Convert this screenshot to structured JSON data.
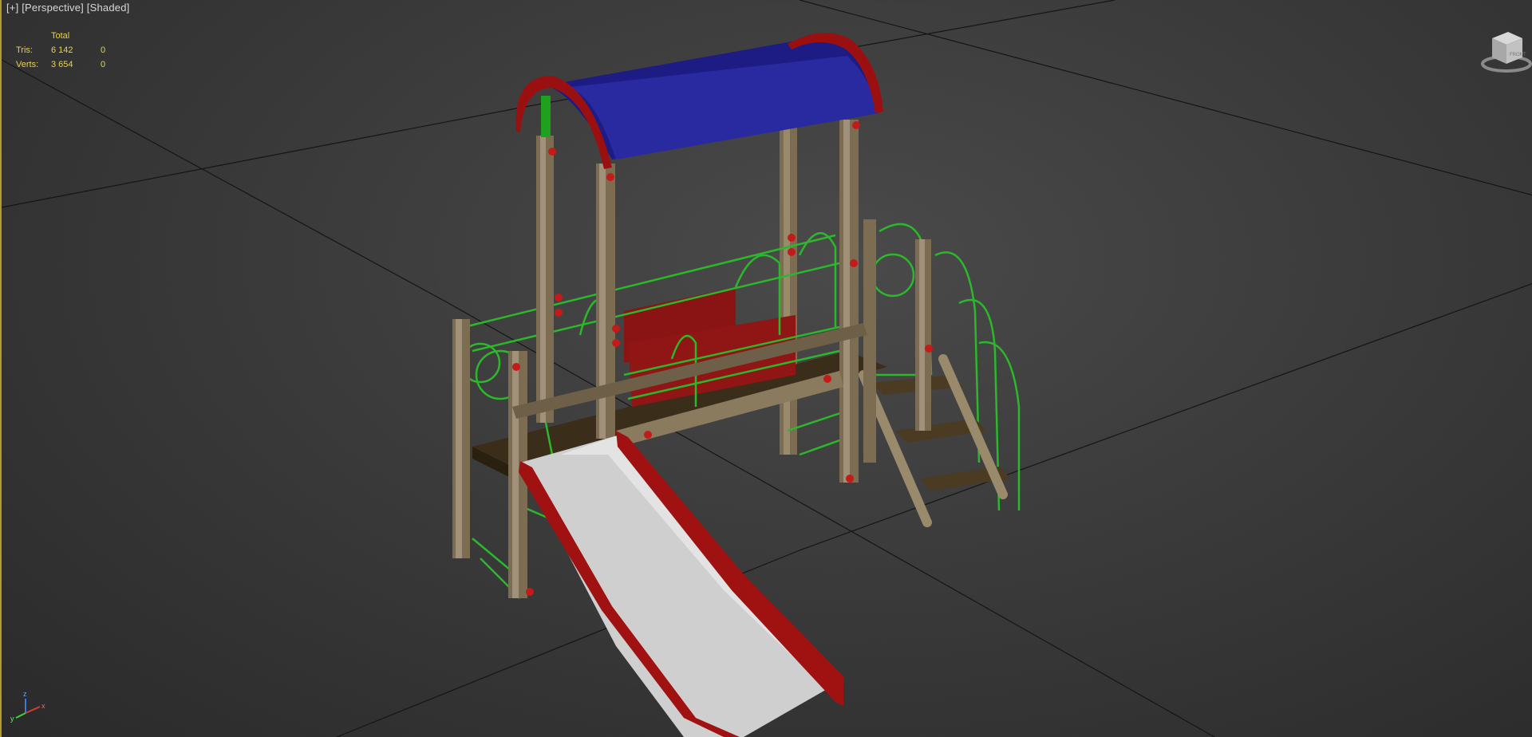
{
  "viewport": {
    "label": {
      "plus": "[+]",
      "view": "[Perspective]",
      "shading": "[Shaded]"
    },
    "stats": {
      "header": "Total",
      "rows": [
        {
          "label": "Tris:",
          "total": "6 142",
          "selected": "0"
        },
        {
          "label": "Verts:",
          "total": "3 654",
          "selected": "0"
        }
      ]
    },
    "viewcube": {
      "face_label": "FRONT"
    },
    "axis_tripod": {
      "z": "z",
      "x": "x",
      "y": "y"
    }
  },
  "colors": {
    "accent_border": "#b59a2f",
    "stats_text": "#e8d34a",
    "roof": "#1f1f8a",
    "roof_trim": "#8a1010",
    "post": "#8a7a5e",
    "rail": "#2aa82a",
    "slide": "#d2d2d2",
    "slide_edge": "#a01212",
    "panel": "#8a1414"
  }
}
